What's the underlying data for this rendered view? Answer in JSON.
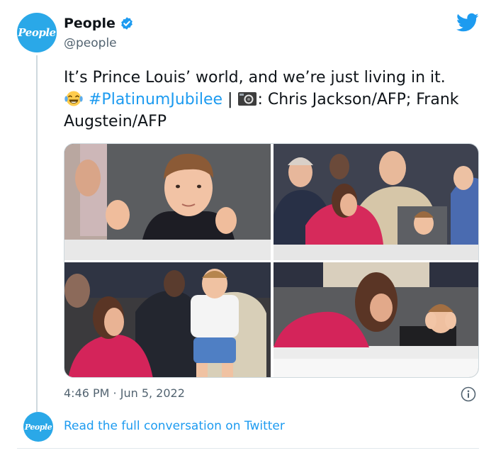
{
  "author": {
    "display_name": "People",
    "handle": "@people",
    "avatar_text": "People",
    "verified": true
  },
  "tweet": {
    "text_main": "It’s Prince Louis’ world, and we’re just living in it.",
    "emoji": "joy-emoji",
    "hashtag": "#PlatinumJubilee",
    "separator": "|",
    "credit_text": ": Chris Jackson/AFP; Frank Augstein/AFP",
    "timestamp": "4:46 PM · Jun 5, 2022"
  },
  "media": {
    "count": 4,
    "photos": [
      {
        "name": "photo-prince-louis-fists"
      },
      {
        "name": "photo-royal-box-crowd"
      },
      {
        "name": "photo-louis-standing"
      },
      {
        "name": "photo-louis-covering-ears"
      }
    ]
  },
  "footer": {
    "link_label": "Read the full conversation on Twitter",
    "avatar_text": "People"
  },
  "colors": {
    "accent": "#1d9bf0",
    "avatar_bg": "#2aa8e8",
    "secondary_text": "#536471"
  },
  "icons": {
    "verified": "verified-badge-icon",
    "brand": "twitter-bird-icon",
    "info": "info-icon",
    "camera": "camera-icon"
  }
}
